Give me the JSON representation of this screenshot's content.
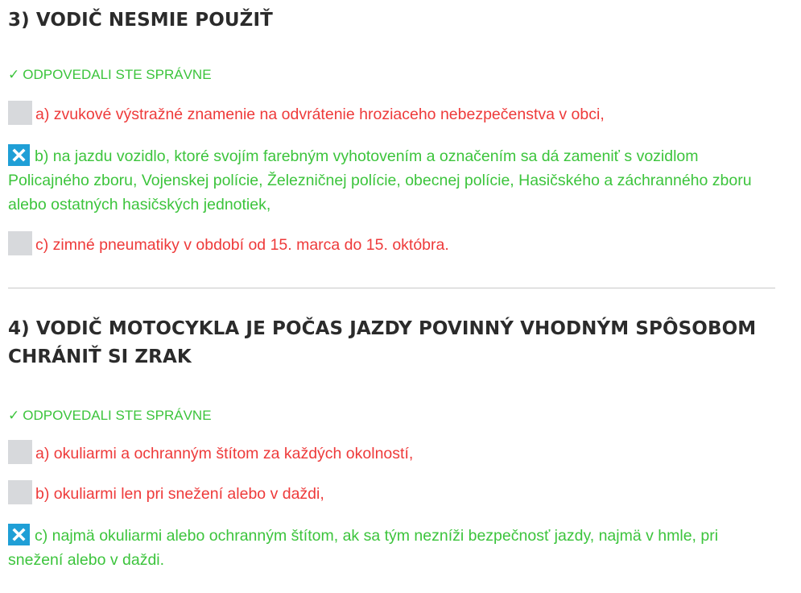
{
  "questions": [
    {
      "title": "3) VODIČ NESMIE POUŽIŤ",
      "status_mark": "✓",
      "status": "ODPOVEDALI STE SPRÁVNE",
      "answers": [
        {
          "text": "a) zvukové výstražné znamenie na odvrátenie hroziaceho nebezpečenstva v obci,",
          "selected": false,
          "correct": false
        },
        {
          "text": "b) na jazdu vozidlo, ktoré svojím farebným vyhotovením a označením sa dá zameniť s vozidlom Policajného zboru, Vojenskej polície, Železničnej polície, obecnej polície, Hasičského a záchranného zboru alebo ostatných hasičských jednotiek,",
          "selected": true,
          "correct": true
        },
        {
          "text": "c) zimné pneumatiky v období od 15. marca do 15. októbra.",
          "selected": false,
          "correct": false
        }
      ]
    },
    {
      "title": "4) VODIČ MOTOCYKLA JE POČAS JAZDY POVINNÝ VHODNÝM SPÔSOBOM CHRÁNIŤ SI ZRAK",
      "status_mark": "✓",
      "status": "ODPOVEDALI STE SPRÁVNE",
      "answers": [
        {
          "text": "a) okuliarmi a ochranným štítom za každých okolností,",
          "selected": false,
          "correct": false
        },
        {
          "text": "b) okuliarmi len pri snežení alebo v daždi,",
          "selected": false,
          "correct": false
        },
        {
          "text": "c) najmä okuliarmi alebo ochranným štítom, ak sa tým nezníži bezpečnosť jazdy, najmä v hmle, pri snežení alebo v daždi.",
          "selected": true,
          "correct": true
        }
      ]
    }
  ],
  "colors": {
    "correct": "#3cc43c",
    "wrong": "#ee3a3a",
    "checkbox_checked": "#1f9fd6",
    "checkbox_empty": "#d7d9dc"
  },
  "icons": {
    "checked": "close-x-icon",
    "status": "check-mark-icon"
  }
}
